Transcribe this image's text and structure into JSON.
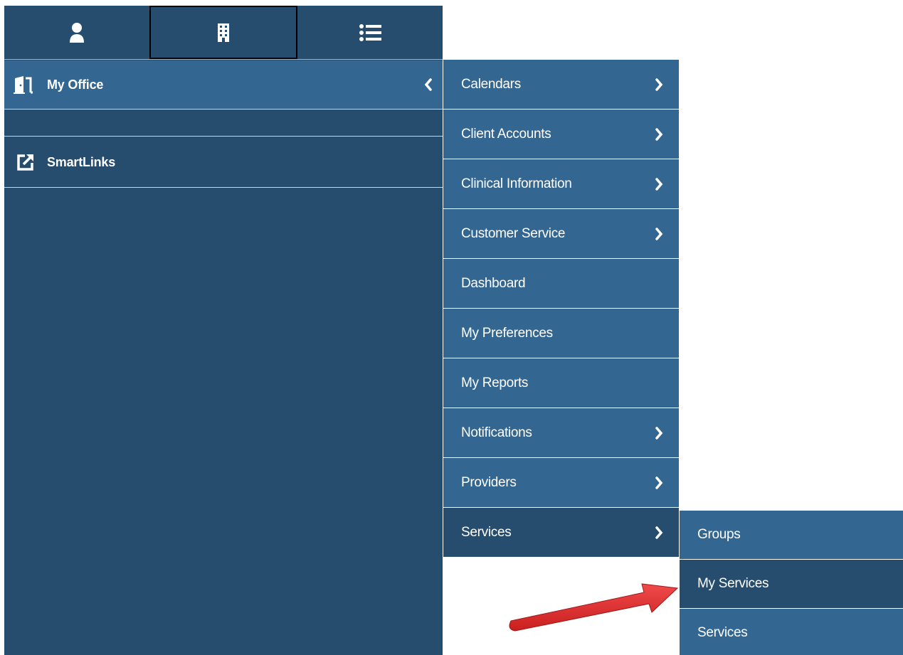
{
  "top_tabs": [
    {
      "icon": "user-icon"
    },
    {
      "icon": "building-icon",
      "active": true
    },
    {
      "icon": "list-icon"
    }
  ],
  "sidebar": {
    "my_office": {
      "label": "My Office",
      "icon": "office-door-icon"
    },
    "smartlinks": {
      "label": "SmartLinks",
      "icon": "external-link-icon"
    }
  },
  "submenu": {
    "items": [
      {
        "label": "Calendars",
        "has_children": true
      },
      {
        "label": "Client Accounts",
        "has_children": true
      },
      {
        "label": "Clinical Information",
        "has_children": true
      },
      {
        "label": "Customer Service",
        "has_children": true
      },
      {
        "label": "Dashboard",
        "has_children": false
      },
      {
        "label": "My Preferences",
        "has_children": false
      },
      {
        "label": "My Reports",
        "has_children": false
      },
      {
        "label": "Notifications",
        "has_children": true
      },
      {
        "label": "Providers",
        "has_children": true
      },
      {
        "label": "Services",
        "has_children": true,
        "selected": true
      }
    ]
  },
  "services_submenu": {
    "items": [
      {
        "label": "Groups"
      },
      {
        "label": "My Services",
        "selected": true
      },
      {
        "label": "Services"
      }
    ]
  },
  "colors": {
    "sidebar_bg": "#264d6e",
    "item_bg": "#336791",
    "selected_bg": "#264d6e",
    "arrow": "#e03131"
  }
}
